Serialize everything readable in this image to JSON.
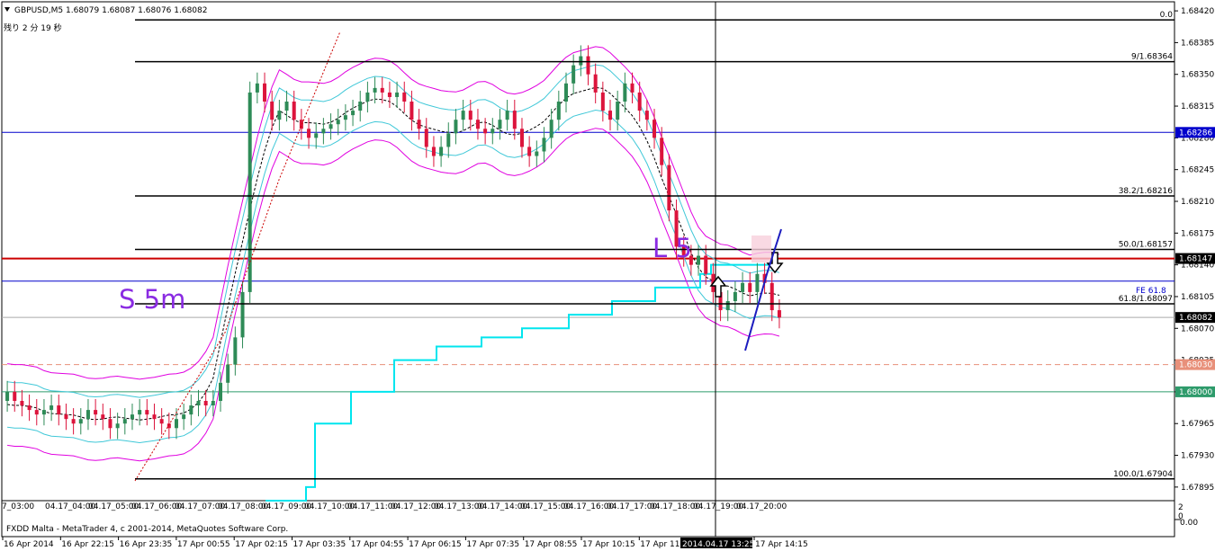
{
  "header": {
    "symbol_line": "GBPUSD,M5  1.68079 1.68087 1.68076 1.68082",
    "timer": "残り 2 分 19 秒"
  },
  "footer": {
    "copyright": "FXDD Malta - MetaTrader 4, c 2001-2014, MetaQuotes Software Corp."
  },
  "sub_axis": [
    "2",
    "0",
    "0.00"
  ],
  "annotations": {
    "short": "S 5m",
    "long": "L 5",
    "fe": "FE 61.8"
  },
  "colors": {
    "candle_up": "#2e8b57",
    "candle_down": "#dc143c",
    "band_outer": "#e000e0",
    "band_inner": "#40c8d8",
    "stepline": "#00e5ee",
    "fib": "#000000",
    "blue_level": "#0000cc",
    "red_level": "#cc0000",
    "green_level": "#2e9b6b",
    "salmon_level": "#e8907a",
    "trend": "#1c1cbf"
  },
  "chart_data": {
    "type": "candlestick",
    "symbol": "GBPUSD",
    "timeframe": "M5",
    "ylim": [
      1.6788,
      1.6843
    ],
    "y_ticks": [
      1.6842,
      1.68385,
      1.6835,
      1.68315,
      1.6828,
      1.68245,
      1.6821,
      1.68175,
      1.6814,
      1.68105,
      1.6807,
      1.68035,
      1.68,
      1.67965,
      1.6793,
      1.67895
    ],
    "x_ticks_small": [
      "7_03:00",
      "04.17_04:00",
      "04.17_05:00",
      "04.17_06:00",
      "04.17_07:00",
      "04.17_08:00",
      "04.17_09:00",
      "04.17_10:00",
      "04.17_11:00",
      "04.17_12:00",
      "04.17_13:00",
      "04.17_14:00",
      "04.17_15:00",
      "04.17_16:00",
      "04.17_17:00",
      "04.17_18:00",
      "04.17_19:00",
      "04.17_20:00"
    ],
    "x_ticks_bottom": [
      "16 Apr 2014",
      "16 Apr 22:15",
      "16 Apr 23:35",
      "17 Apr 00:55",
      "17 Apr 02:15",
      "17 Apr 03:35",
      "17 Apr 04:55",
      "17 Apr 06:15",
      "17 Apr 07:35",
      "17 Apr 08:55",
      "17 Apr 10:15",
      "17 Apr 11:3",
      "17 Apr 14:15"
    ],
    "crosshair_time": "2014.04.17 13:25",
    "fib_levels": [
      {
        "label": "0.0",
        "value": 1.6841
      },
      {
        "label": "9/1.68364",
        "value": 1.68364
      },
      {
        "label": "38.2/1.68216",
        "value": 1.68216
      },
      {
        "label": "50.0/1.68157",
        "value": 1.68157
      },
      {
        "label": "61.8/1.68097",
        "value": 1.68097
      },
      {
        "label": "100.0/1.67904",
        "value": 1.67904
      }
    ],
    "price_tags": [
      {
        "text": "1.68286",
        "value": 1.68286,
        "color": "#0000cc"
      },
      {
        "text": "1.68147",
        "value": 1.68147,
        "color": "#000000"
      },
      {
        "text": "1.68082",
        "value": 1.68082,
        "color": "#000000"
      },
      {
        "text": "1.68030",
        "value": 1.6803,
        "color": "#e8907a"
      },
      {
        "text": "1.68000",
        "value": 1.68,
        "color": "#2e9b6b"
      }
    ],
    "horizontal_levels": [
      {
        "value": 1.68286,
        "color": "#0000cc",
        "style": "solid"
      },
      {
        "value": 1.68147,
        "color": "#cc0000",
        "style": "thick"
      },
      {
        "value": 1.68122,
        "color": "#0000cc",
        "style": "solid"
      },
      {
        "value": 1.68082,
        "color": "#aaaaaa",
        "style": "solid"
      },
      {
        "value": 1.6803,
        "color": "#e8907a",
        "style": "dashed"
      },
      {
        "value": 1.68,
        "color": "#2e9b6b",
        "style": "solid"
      }
    ],
    "close_profile": [
      1.68,
      1.6799,
      1.67985,
      1.6798,
      1.67975,
      1.6798,
      1.67985,
      1.67975,
      1.6797,
      1.67965,
      1.6797,
      1.6798,
      1.67975,
      1.6797,
      1.6796,
      1.67965,
      1.6797,
      1.67975,
      1.6798,
      1.67975,
      1.6797,
      1.67965,
      1.6796,
      1.6797,
      1.67975,
      1.67985,
      1.6799,
      1.67985,
      1.6799,
      1.6801,
      1.6803,
      1.6806,
      1.6811,
      1.6833,
      1.6834,
      1.6832,
      1.683,
      1.6831,
      1.6832,
      1.683,
      1.6829,
      1.6828,
      1.68285,
      1.6829,
      1.68295,
      1.683,
      1.68305,
      1.6831,
      1.6832,
      1.6833,
      1.68335,
      1.6833,
      1.68325,
      1.6833,
      1.6832,
      1.683,
      1.6829,
      1.6827,
      1.6826,
      1.6827,
      1.68285,
      1.683,
      1.6831,
      1.683,
      1.6829,
      1.68285,
      1.6829,
      1.683,
      1.6831,
      1.6829,
      1.6827,
      1.6826,
      1.68265,
      1.6828,
      1.683,
      1.6832,
      1.6834,
      1.6836,
      1.6837,
      1.6835,
      1.6833,
      1.6831,
      1.683,
      1.6832,
      1.6834,
      1.6833,
      1.6831,
      1.683,
      1.6828,
      1.6825,
      1.682,
      1.6816,
      1.6815,
      1.6814,
      1.6815,
      1.6813,
      1.6811,
      1.6809,
      1.681,
      1.6811,
      1.6812,
      1.6811,
      1.6813,
      1.6812,
      1.6809,
      1.68082
    ]
  }
}
